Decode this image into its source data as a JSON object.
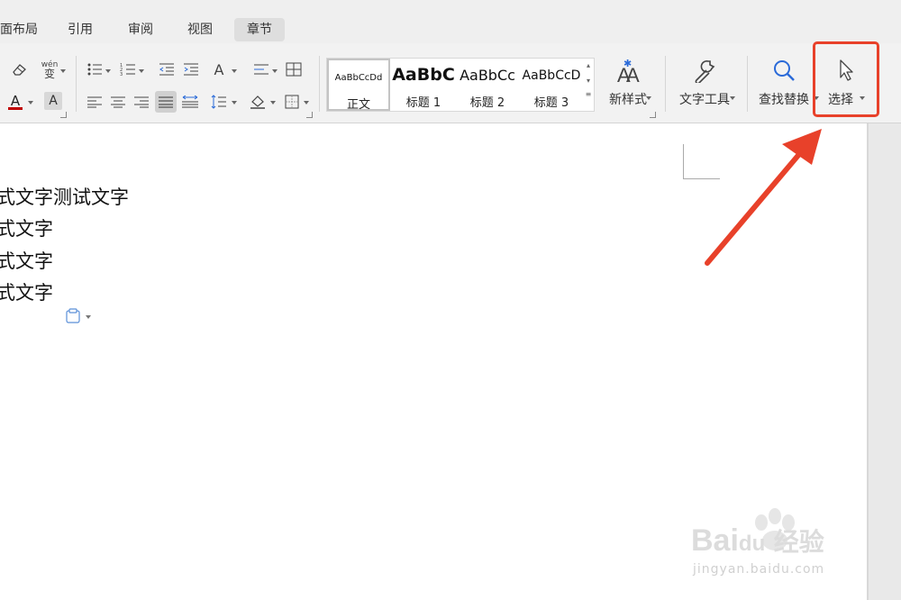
{
  "tabs": [
    {
      "label": "面布局",
      "active": false
    },
    {
      "label": "引用",
      "active": false
    },
    {
      "label": "审阅",
      "active": false
    },
    {
      "label": "视图",
      "active": false
    },
    {
      "label": "章节",
      "active": true
    }
  ],
  "toolbar": {
    "phonetic_glyph": "wén",
    "phonetic_char": "变"
  },
  "styles": [
    {
      "sample": "AaBbCcDd",
      "name": "正文",
      "selected": true
    },
    {
      "sample": "AaBbC",
      "name": "标题 1",
      "selected": false
    },
    {
      "sample": "AaBbCc",
      "name": "标题 2",
      "selected": false
    },
    {
      "sample": "AaBbCcD",
      "name": "标题 3",
      "selected": false
    }
  ],
  "buttons": {
    "new_style": "新样式",
    "text_tools": "文字工具",
    "find_replace": "查找替换",
    "select": "选择"
  },
  "document": {
    "lines": [
      "式文字测试文字",
      "式文字",
      "式文字",
      "式文字"
    ]
  },
  "watermark": {
    "brand": "Bai",
    "brand2": "du",
    "cn": "经验",
    "url": "jingyan.baidu.com"
  },
  "colors": {
    "highlight": "#e8412a",
    "font_color_bar": "#c00000",
    "ribbon_bg": "#f2f2f2"
  }
}
